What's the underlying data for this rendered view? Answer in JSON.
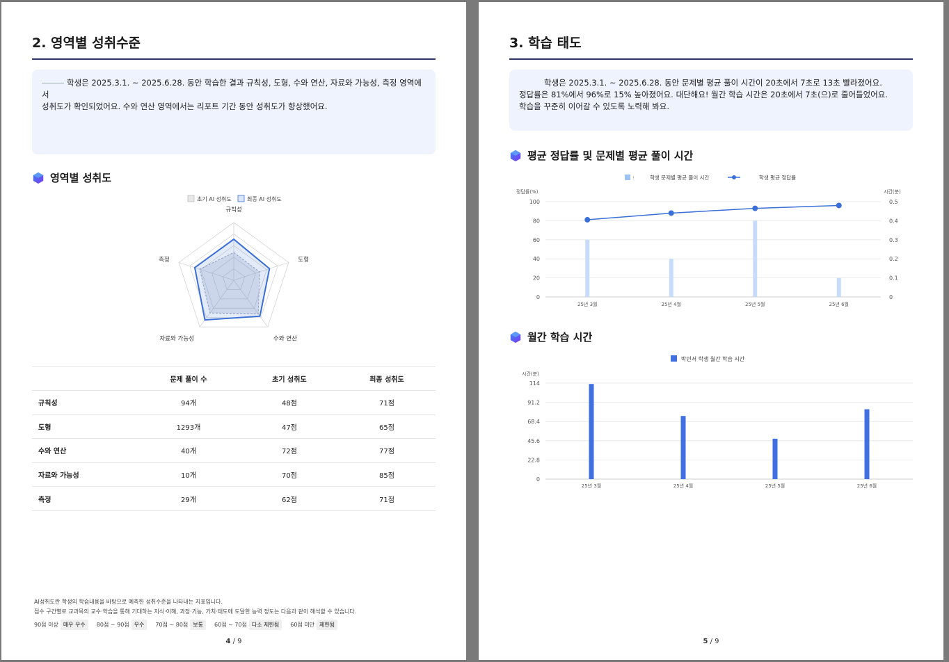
{
  "page4": {
    "section_title": "2. 영역별 성취수준",
    "summary_prefix": "학생은 2025.3.1. ~ 2025.6.28. 동안 학습한 결과 규칙성, 도형, 수와 연산, 자료와 가능성, 측정 영역에서",
    "summary_rest": "성취도가 확인되었어요. 수와 연산 영역에서는 리포트 기간 동안 성취도가 향상했어요.",
    "radar_title": "영역별 성취도",
    "chart_data": {
      "type": "radar",
      "categories": [
        "규칙성",
        "도형",
        "수와 연산",
        "자료와 가능성",
        "측정"
      ],
      "series": [
        {
          "name": "초기 AI 성취도",
          "values": [
            48,
            47,
            72,
            70,
            62
          ]
        },
        {
          "name": "최종 AI 성취도",
          "values": [
            71,
            65,
            77,
            85,
            71
          ]
        }
      ],
      "range": [
        0,
        100
      ],
      "legend_position": "top"
    },
    "table": {
      "headers": [
        "",
        "문제 풀이 수",
        "초기 성취도",
        "최종 성취도"
      ],
      "rows": [
        [
          "규칙성",
          "94개",
          "48점",
          "71점"
        ],
        [
          "도형",
          "1293개",
          "47점",
          "65점"
        ],
        [
          "수와 연산",
          "40개",
          "72점",
          "77점"
        ],
        [
          "자료와 가능성",
          "10개",
          "70점",
          "85점"
        ],
        [
          "측정",
          "29개",
          "62점",
          "71점"
        ]
      ]
    },
    "footnote_line1": "AI성취도란 학생의 학습내용을 바탕으로 예측한 성취수준을 나타내는 지표입니다.",
    "footnote_line2": "점수 구간별로 교과목의 교수·학습을 통해 기대하는 지식·이해, 과정·기능, 가치·태도에 도달한 능력 정도는 다음과 같이 해석할 수 있습니다.",
    "grades": [
      {
        "range": "90점 이상",
        "level": "매우 우수"
      },
      {
        "range": "80점 ~ 90점",
        "level": "우수"
      },
      {
        "range": "70점 ~ 80점",
        "level": "보통"
      },
      {
        "range": "60점 ~ 70점",
        "level": "다소 제한됨"
      },
      {
        "range": "60점 미만",
        "level": "제한됨"
      }
    ],
    "page_current": "4",
    "page_total": " / 9"
  },
  "page5": {
    "section_title": "3. 학습 태도",
    "summary_line1": "학생은 2025.3.1. ~ 2025.6.28. 동안 문제별 평균 풀이 시간이 20초에서 7초로 13초 빨라졌어요.",
    "summary_line2": "정답률은 81%에서 96%로 15% 높아졌어요. 대단해요! 월간 학습 시간은 20초에서 7초(으)로 줄어들었어요.",
    "summary_line3": "학습을 꾸준히 이어갈 수 있도록 노력해 봐요.",
    "chart1_title": "평균 정답률 및 문제별 평균 풀이 시간",
    "chart2_title": "월간 학습 시간",
    "chart_data": [
      {
        "type": "bar+line",
        "categories": [
          "25년 3월",
          "25년 4월",
          "25년 5월",
          "25년 6월"
        ],
        "series": [
          {
            "name": "학생 문제별 평균 풀이 시간",
            "type": "bar",
            "axis": "right",
            "values": [
              0.3,
              0.2,
              0.4,
              0.1
            ]
          },
          {
            "name": "학생 평균 정답률",
            "type": "line",
            "axis": "left",
            "values": [
              81,
              88,
              93,
              96
            ]
          }
        ],
        "ylabel_left": "정답률(%)",
        "ylabel_right": "시간(분)",
        "ylim_left": [
          0,
          100
        ],
        "yticks_left": [
          "0",
          "20",
          "40",
          "60",
          "80",
          "100"
        ],
        "ylim_right": [
          0,
          0.5
        ],
        "yticks_right": [
          "0",
          "0.1",
          "0.2",
          "0.3",
          "0.4",
          "0.5"
        ],
        "legend_position": "top",
        "grid": true
      },
      {
        "type": "bar",
        "categories": [
          "25년 3월",
          "25년 4월",
          "25년 5월",
          "25년 6월"
        ],
        "series": [
          {
            "name": "박민서 학생 월간 학습 시간",
            "values": [
              113,
              75,
              48,
              83
            ]
          }
        ],
        "ylabel": "시간(분)",
        "ylim": [
          0,
          114
        ],
        "yticks": [
          "0",
          "22.8",
          "45.6",
          "68.4",
          "91.2",
          "114"
        ],
        "legend_position": "top",
        "grid": true
      }
    ],
    "page_current": "5",
    "page_total": " / 9"
  },
  "colors": {
    "accent_navy": "#2b3566",
    "summary_bg": "#eef3fd",
    "radar_final": "#3a6fd8",
    "radar_initial": "#9aa6c2",
    "bar_light": "#c6dcf8",
    "line_blue": "#3a6fd8",
    "bar_blue": "#3f6fe0"
  }
}
